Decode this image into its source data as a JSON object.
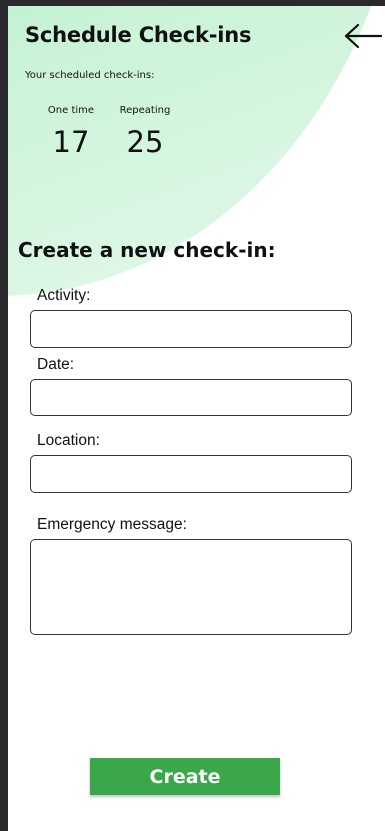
{
  "header": {
    "title": "Schedule Check-ins",
    "back_icon": "arrow-left-icon"
  },
  "summary": {
    "subtitle": "Your scheduled check-ins:",
    "one_time": {
      "label": "One time",
      "value": "17"
    },
    "repeating": {
      "label": "Repeating",
      "value": "25"
    }
  },
  "form": {
    "heading": "Create a new check-in:",
    "fields": [
      {
        "label": "Activity:",
        "value": ""
      },
      {
        "label": "Date:",
        "value": ""
      },
      {
        "label": "Location:",
        "value": ""
      },
      {
        "label": "Emergency message:",
        "value": ""
      }
    ],
    "submit_label": "Create"
  },
  "colors": {
    "accent_green": "#43d87d",
    "button_green": "#3aa84a"
  }
}
